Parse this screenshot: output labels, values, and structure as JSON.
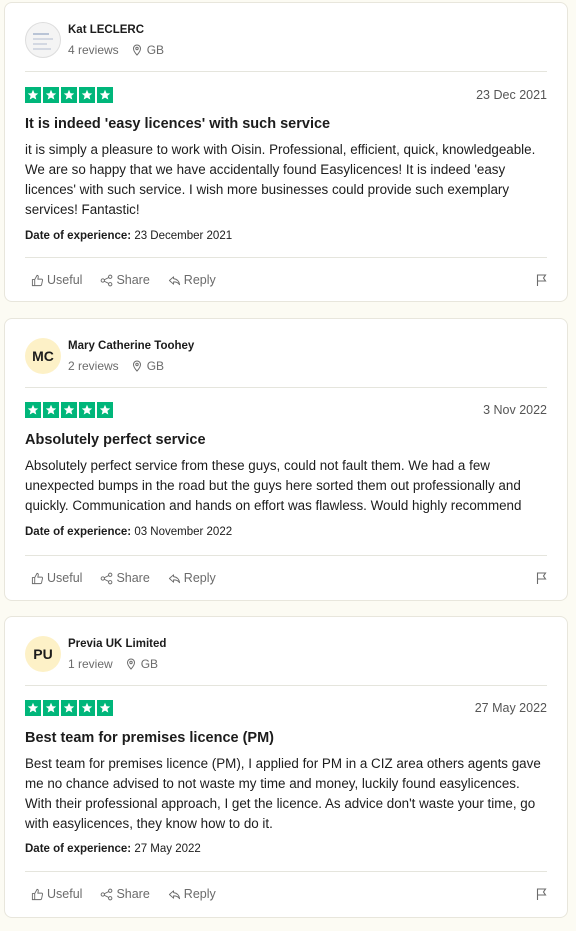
{
  "reviews": [
    {
      "name": "Kat LECLERC",
      "reviews_count": "4 reviews",
      "country": "GB",
      "avatar_initials": "",
      "date": "23 Dec 2021",
      "title": "It is indeed 'easy licences' with such service",
      "body": "it is simply a pleasure to work with Oisin. Professional, efficient, quick, knowledgeable. We are so happy that we have accidentally found Easylicences! It is indeed 'easy licences' with such service. I wish more businesses could provide such exemplary services! Fantastic!",
      "experience_label": "Date of experience:",
      "experience_date": "23 December 2021",
      "rating": 5
    },
    {
      "name": "Mary Catherine Toohey",
      "reviews_count": "2 reviews",
      "country": "GB",
      "avatar_initials": "MC",
      "date": "3 Nov 2022",
      "title": "Absolutely perfect service",
      "body": "Absolutely perfect service from these guys, could not fault them. We had a few unexpected bumps in the road but the guys here sorted them out professionally and quickly. Communication and hands on effort was flawless. Would highly recommend",
      "experience_label": "Date of experience:",
      "experience_date": "03 November 2022",
      "rating": 5
    },
    {
      "name": "Previa UK Limited",
      "reviews_count": "1 review",
      "country": "GB",
      "avatar_initials": "PU",
      "date": "27 May 2022",
      "title": "Best team for premises licence (PM)",
      "body": "Best team for premises licence (PM), I applied for PM in a CIZ area others agents gave me no chance advised to not waste my time and money, luckily found easylicences. With their professional approach, I get the licence. As advice don't waste your time, go with easylicences, they know how to do it.",
      "experience_label": "Date of experience:",
      "experience_date": "27 May 2022",
      "rating": 5
    }
  ],
  "actions": {
    "useful": "Useful",
    "share": "Share",
    "reply": "Reply"
  },
  "colors": {
    "star_green": "#00b67a",
    "avatar_bg": "#fdf1c7",
    "page_bg": "#fcfbf3"
  }
}
